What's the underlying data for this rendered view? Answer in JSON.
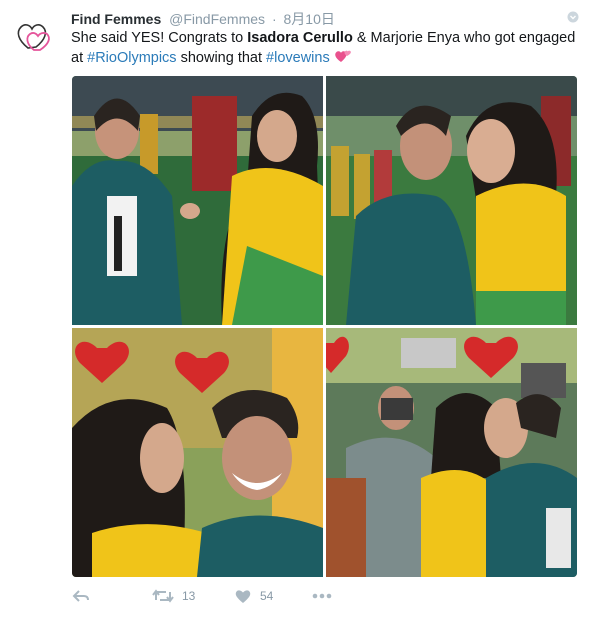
{
  "tweet": {
    "display_name": "Find Femmes",
    "handle": "@FindFemmes",
    "separator": "·",
    "date": "8月10日",
    "text": {
      "part1": "She said YES! Congrats to ",
      "bold": "Isadora Cerullo",
      "part2": " & Marjorie Enya who got engaged at ",
      "hashtag1": "#RioOlympics",
      "part3": " showing that  ",
      "hashtag2": "#lovewins"
    },
    "retweet_count": "13",
    "like_count": "54"
  },
  "icons": [
    "avatar-hearts-icon",
    "caret-icon",
    "two-hearts-emoji-icon",
    "reply-icon",
    "retweet-icon",
    "like-icon",
    "more-icon"
  ],
  "colors": {
    "link": "#2b7bb9",
    "meta": "#8899a6",
    "brazil_green": "#1f7a7a",
    "jersey_yellow": "#f2c418"
  }
}
